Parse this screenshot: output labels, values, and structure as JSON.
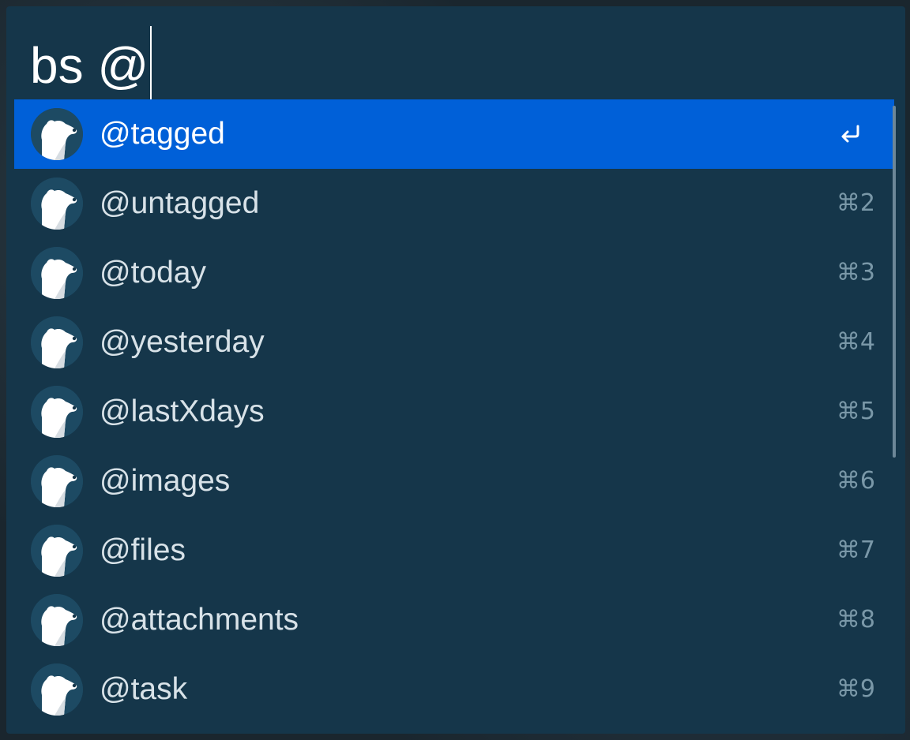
{
  "search": {
    "query": "bs @"
  },
  "results": [
    {
      "label": "@tagged",
      "shortcut": "",
      "selected": true
    },
    {
      "label": "@untagged",
      "shortcut": "⌘2"
    },
    {
      "label": "@today",
      "shortcut": "⌘3"
    },
    {
      "label": "@yesterday",
      "shortcut": "⌘4"
    },
    {
      "label": "@lastXdays",
      "shortcut": "⌘5"
    },
    {
      "label": "@images",
      "shortcut": "⌘6"
    },
    {
      "label": "@files",
      "shortcut": "⌘7"
    },
    {
      "label": "@attachments",
      "shortcut": "⌘8"
    },
    {
      "label": "@task",
      "shortcut": "⌘9"
    }
  ],
  "icons": {
    "result_icon": "bear-app-icon",
    "action_icon": "return-key-icon"
  },
  "colors": {
    "window_background": "#15364a",
    "selection": "#0060d8",
    "text": "#d8e2e8",
    "shortcut_text": "#7a98a8"
  }
}
